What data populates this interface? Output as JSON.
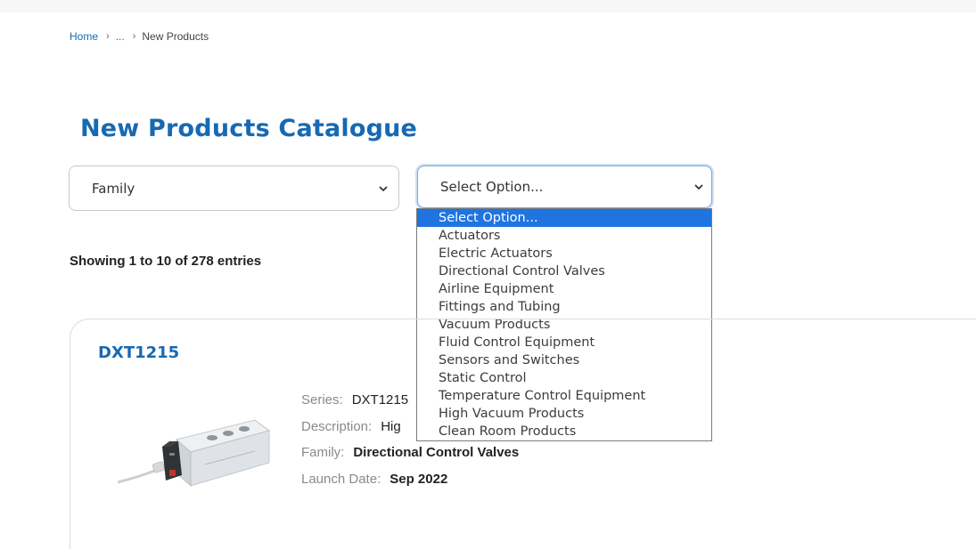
{
  "breadcrumb": {
    "home": "Home",
    "ellipsis": "...",
    "current": "New Products"
  },
  "page_title": "New Products Catalogue",
  "filters": {
    "family_select": {
      "value": "Family",
      "icon": "chevron-down-icon"
    },
    "option_select": {
      "value": "Select Option...",
      "icon": "chevron-down-icon"
    }
  },
  "dropdown": {
    "selected_index": 0,
    "options": [
      "Select Option...",
      "Actuators",
      "Electric Actuators",
      "Directional Control Valves",
      "Airline Equipment",
      "Fittings and Tubing",
      "Vacuum Products",
      "Fluid Control Equipment",
      "Sensors and Switches",
      "Static Control",
      "Temperature Control Equipment",
      "High Vacuum Products",
      "Clean Room Products"
    ],
    "highlight_color": "#1f74e0"
  },
  "results": {
    "showing_text": "Showing 1 to 10 of 278 entries"
  },
  "product": {
    "name": "DXT1215",
    "series_label": "Series:",
    "series_value": "DXT1215",
    "description_label": "Description:",
    "description_value": "Hig",
    "family_label": "Family:",
    "family_value": "Directional Control Valves",
    "launch_label": "Launch Date:",
    "launch_value": "Sep 2022",
    "image": "solenoid-valve-image"
  },
  "colors": {
    "brand_blue": "#1769b3",
    "text_dark": "#222222",
    "label_gray": "#8a8a8a"
  }
}
